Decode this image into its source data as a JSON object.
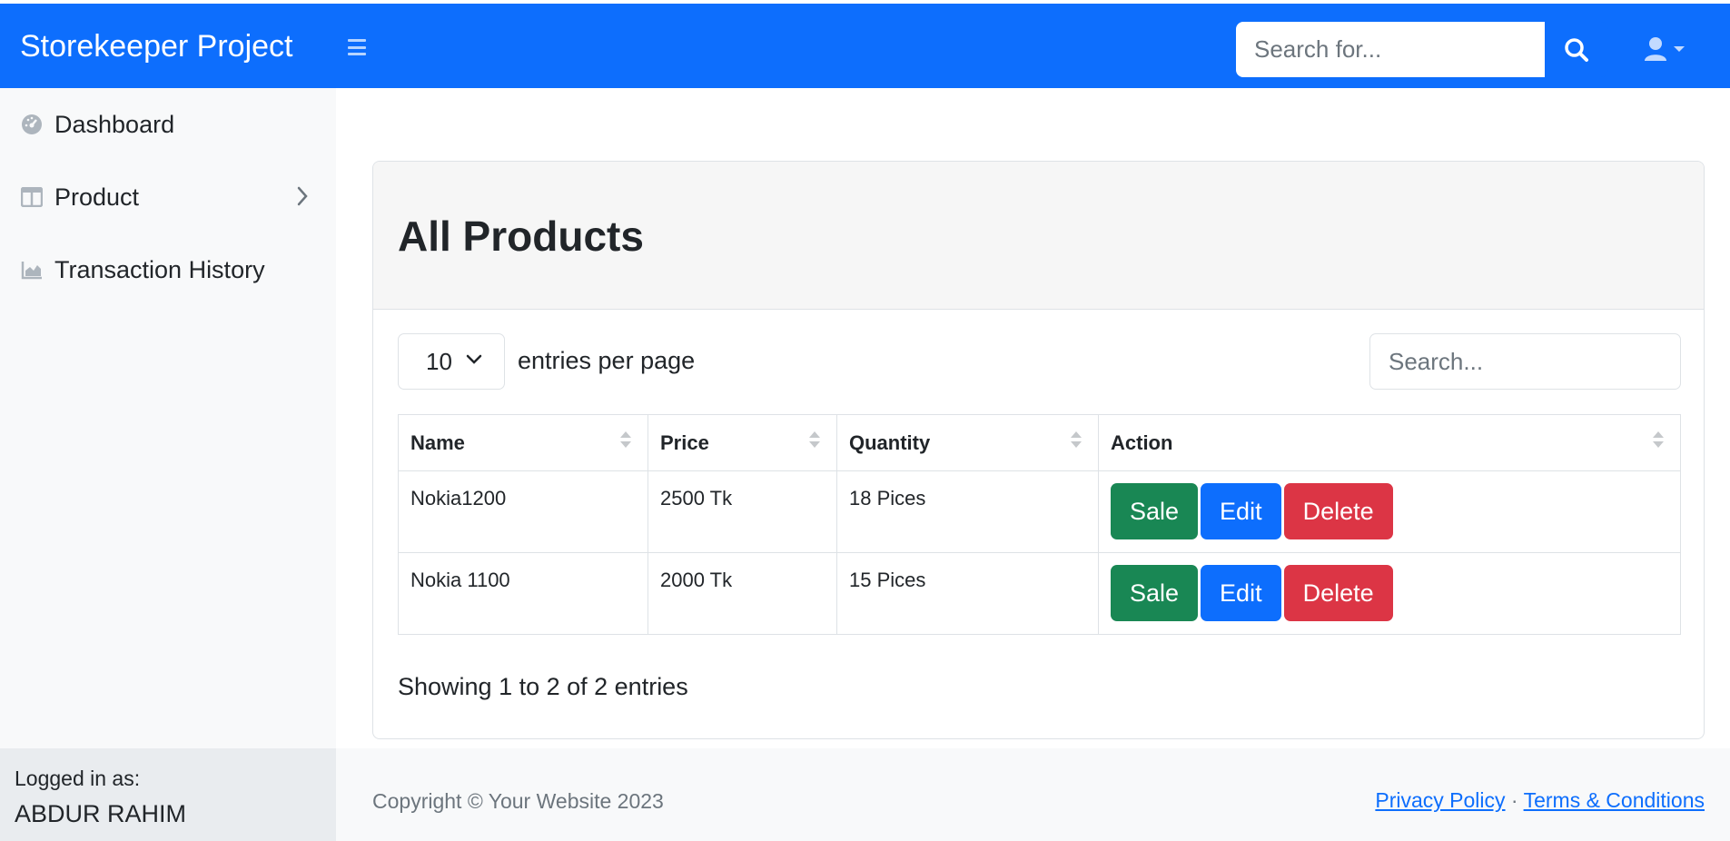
{
  "navbar": {
    "brand": "Storekeeper Project",
    "search_placeholder": "Search for..."
  },
  "sidebar": {
    "items": [
      {
        "label": "Dashboard",
        "icon": "dashboard-icon"
      },
      {
        "label": "Product",
        "icon": "columns-icon"
      },
      {
        "label": "Transaction History",
        "icon": "chart-area-icon"
      }
    ],
    "footer": {
      "logged_in_label": "Logged in as:",
      "user_name": "ABDUR RAHIM"
    }
  },
  "main": {
    "title": "All Products",
    "per_page_value": "10",
    "per_page_label": "entries per page",
    "search_placeholder": "Search...",
    "columns": [
      "Name",
      "Price",
      "Quantity",
      "Action"
    ],
    "rows": [
      {
        "name": "Nokia1200",
        "price": "2500 Tk",
        "quantity": "18 Pices"
      },
      {
        "name": "Nokia 1100",
        "price": "2000 Tk",
        "quantity": "15 Pices"
      }
    ],
    "actions": {
      "sale": "Sale",
      "edit": "Edit",
      "delete": "Delete"
    },
    "showing": "Showing 1 to 2 of 2 entries"
  },
  "footer": {
    "copyright": "Copyright © Your Website 2023",
    "privacy": "Privacy Policy",
    "separator": "·",
    "terms": "Terms & Conditions"
  },
  "colors": {
    "primary": "#0d6efd",
    "success": "#198754",
    "danger": "#dc3545"
  }
}
